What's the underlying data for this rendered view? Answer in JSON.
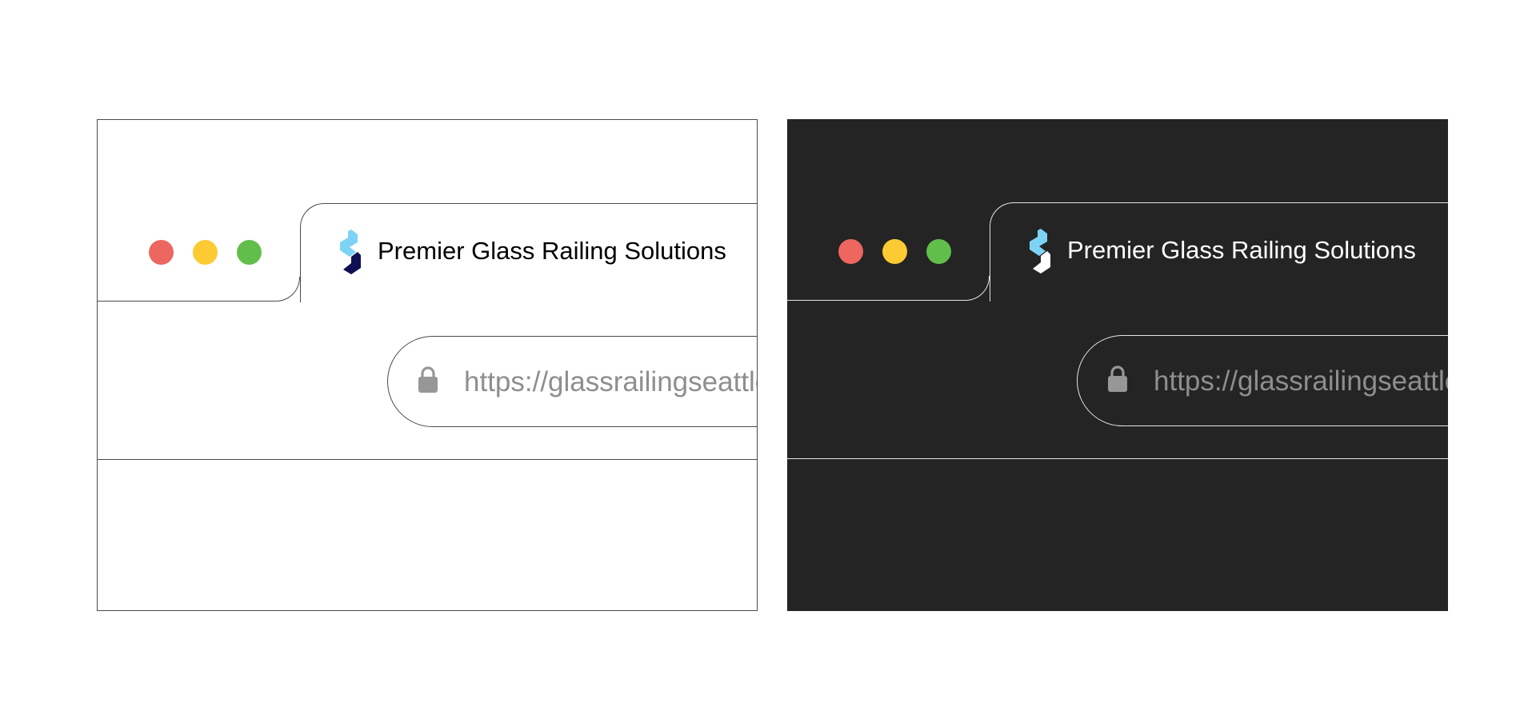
{
  "colors": {
    "close": "#ED665F",
    "minimize": "#FCCB33",
    "maximize": "#62BE4A",
    "favicon_top": "#7DD3F5",
    "favicon_bottom_light": "#0E0F52",
    "favicon_bottom_dark": "#FFFFFF",
    "lock": "#979797",
    "dark_background": "#242424"
  },
  "light_window": {
    "tab": {
      "title": "Premier Glass Railing Solutions",
      "icon": "site-favicon"
    },
    "address_bar": {
      "url": "https://glassrailingseattle.com",
      "icon": "lock-icon"
    }
  },
  "dark_window": {
    "tab": {
      "title": "Premier Glass Railing Solutions",
      "icon": "site-favicon"
    },
    "address_bar": {
      "url": "https://glassrailingseattle.com",
      "icon": "lock-icon"
    }
  }
}
